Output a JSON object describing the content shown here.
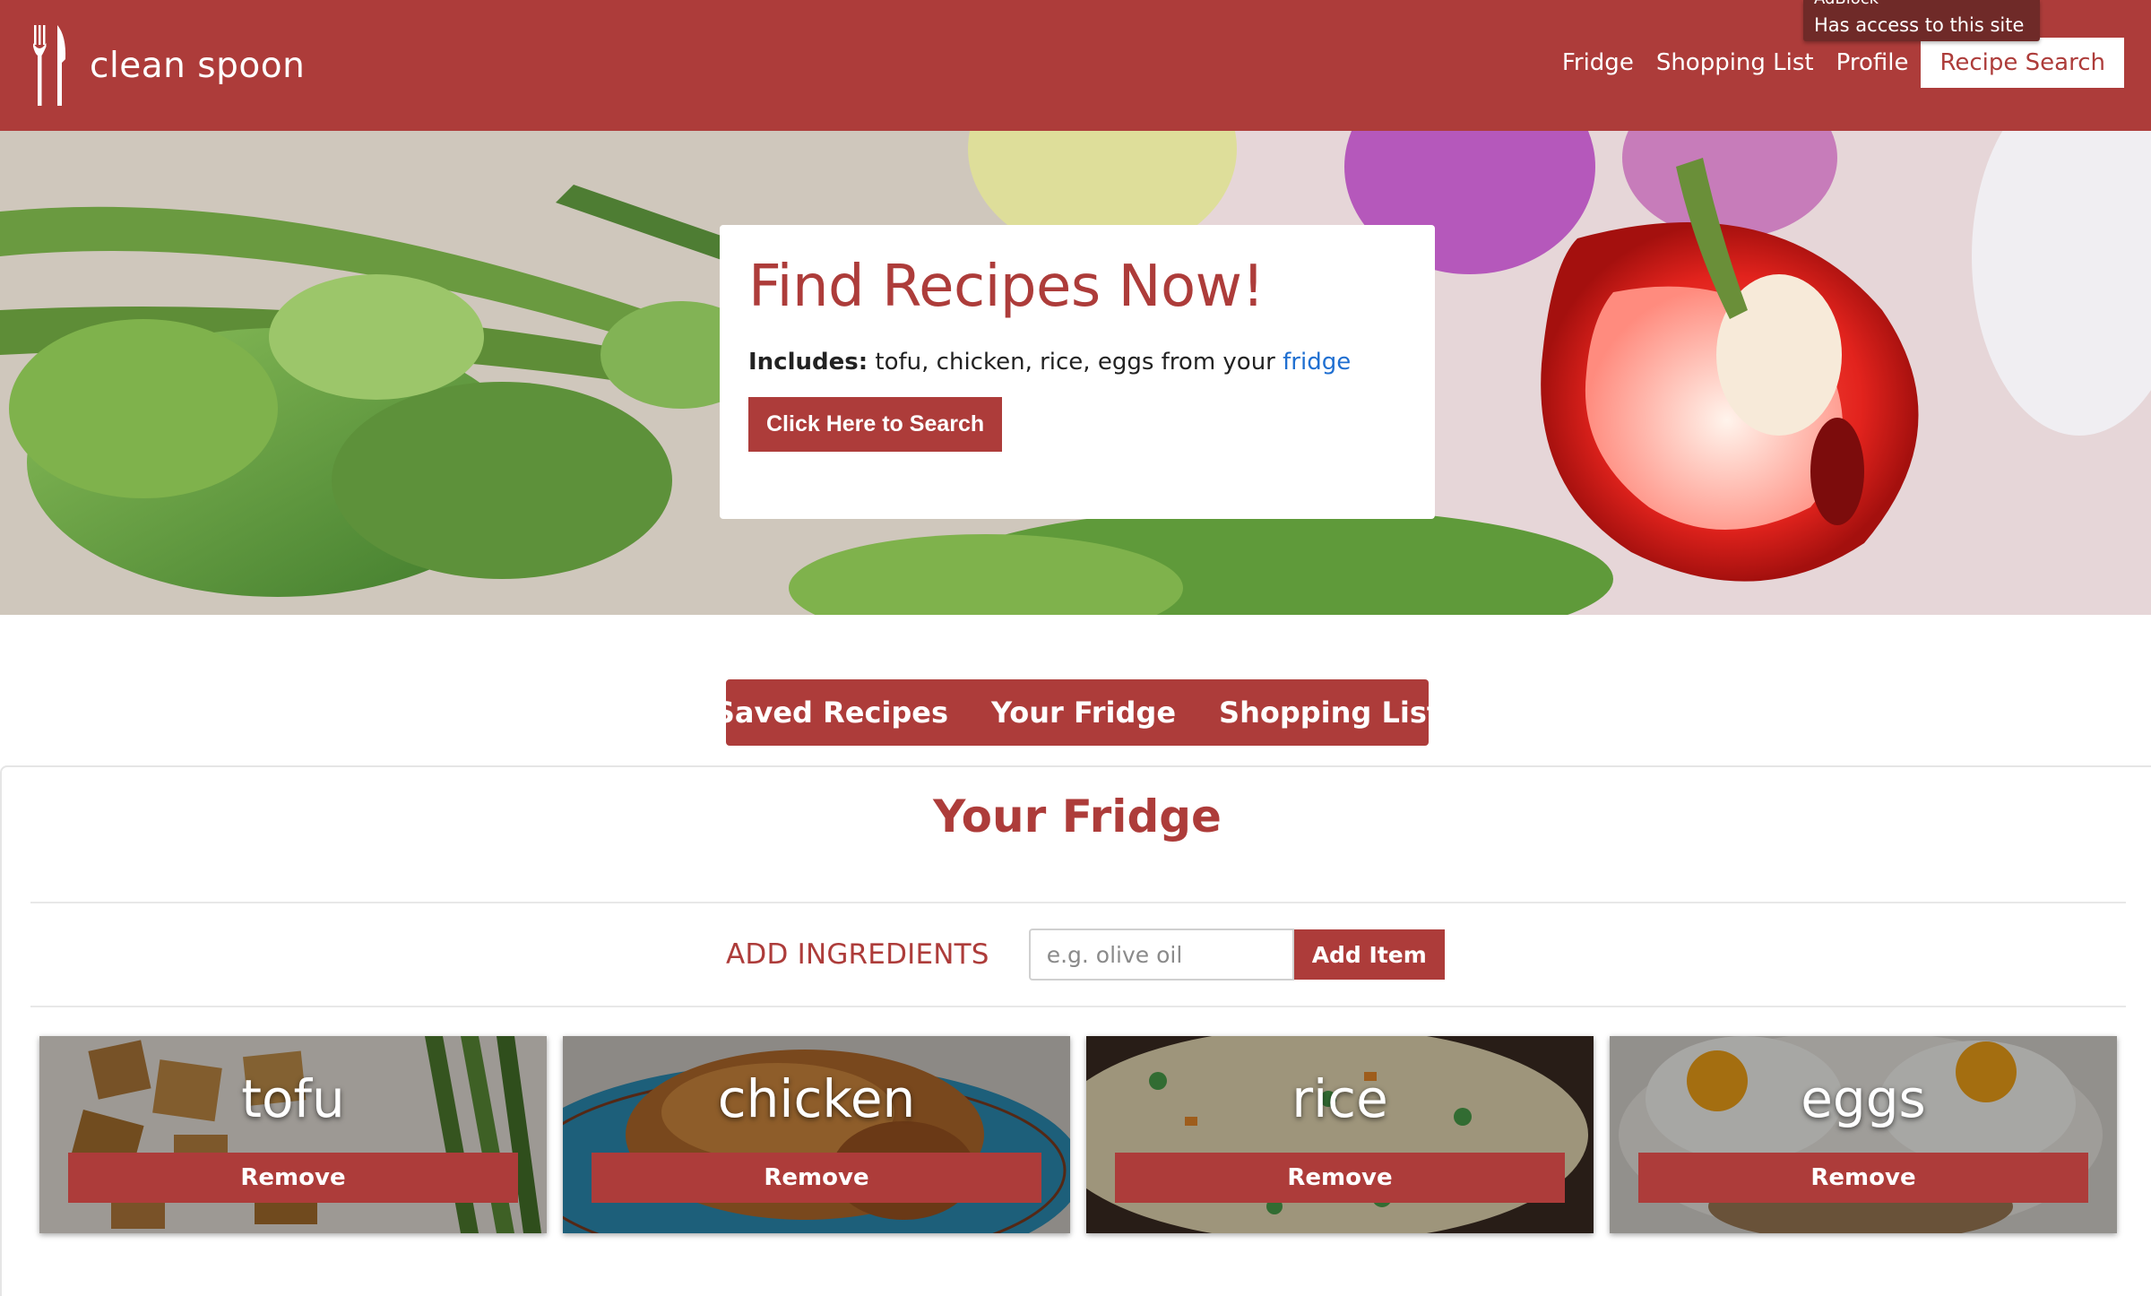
{
  "brand": {
    "name": "clean spoon",
    "icon": "fork-knife-icon"
  },
  "nav": {
    "links": [
      "Fridge",
      "Shopping List",
      "Profile"
    ],
    "active_link": "Recipe Search"
  },
  "extension_tooltip": {
    "name": "AdBlock",
    "message": "Has access to this site"
  },
  "hero": {
    "title": "Find Recipes Now!",
    "includes_label": "Includes:",
    "includes_items": "tofu, chicken, rice, eggs from your",
    "fridge_link": "fridge",
    "button": "Click Here to Search"
  },
  "tabs": [
    "Saved Recipes",
    "Your Fridge",
    "Shopping List"
  ],
  "fridge": {
    "title": "Your Fridge",
    "add_label": "ADD INGREDIENTS",
    "input_placeholder": "e.g. olive oil",
    "add_button": "Add Item",
    "items": [
      {
        "name": "tofu",
        "remove": "Remove"
      },
      {
        "name": "chicken",
        "remove": "Remove"
      },
      {
        "name": "rice",
        "remove": "Remove"
      },
      {
        "name": "eggs",
        "remove": "Remove"
      }
    ]
  },
  "colors": {
    "brand": "#ad3c3a",
    "link": "#1f6fd1"
  }
}
